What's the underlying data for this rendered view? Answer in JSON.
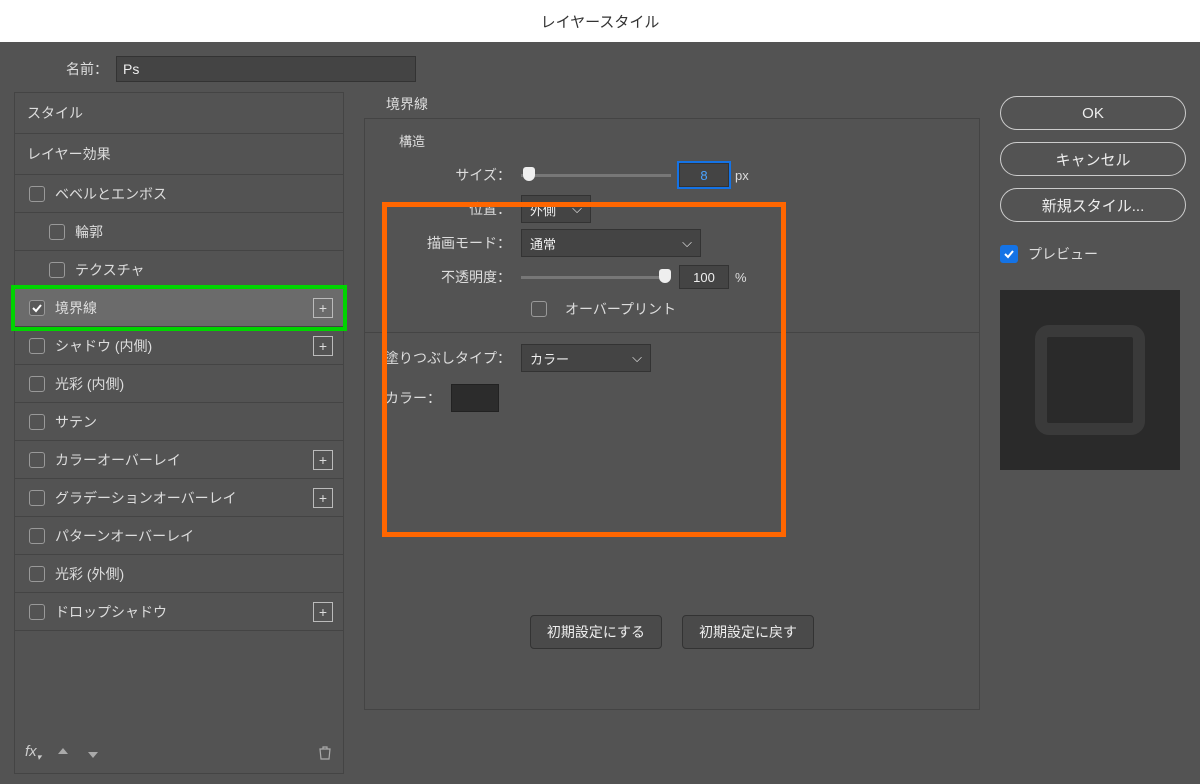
{
  "title": "レイヤースタイル",
  "nameLabel": "名前：",
  "nameValue": "Ps",
  "stylesLabel": "スタイル",
  "effectsLabel": "レイヤー効果",
  "styleItems": {
    "bevel": "ベベルとエンボス",
    "contour": "輪郭",
    "texture": "テクスチャ",
    "stroke": "境界線",
    "innerShadow": "シャドウ (内側)",
    "innerGlow": "光彩 (内側)",
    "satin": "サテン",
    "colorOverlay": "カラーオーバーレイ",
    "gradientOverlay": "グラデーションオーバーレイ",
    "patternOverlay": "パターンオーバーレイ",
    "outerGlow": "光彩 (外側)",
    "dropShadow": "ドロップシャドウ"
  },
  "fxLabel": "fx",
  "section": {
    "title": "境界線",
    "sub": "構造",
    "sizeLabel": "サイズ：",
    "sizeValue": "8",
    "sizeUnit": "px",
    "posLabel": "位置：",
    "posValue": "外側",
    "modeLabel": "描画モード：",
    "modeValue": "通常",
    "opacityLabel": "不透明度：",
    "opacityValue": "100",
    "opacityUnit": "%",
    "overprint": "オーバープリント",
    "fillTypeLabel": "塗りつぶしタイプ：",
    "fillTypeValue": "カラー",
    "colorLabel": "カラー："
  },
  "buttons": {
    "default": "初期設定にする",
    "reset": "初期設定に戻す",
    "ok": "OK",
    "cancel": "キャンセル",
    "newStyle": "新規スタイル...",
    "preview": "プレビュー"
  }
}
